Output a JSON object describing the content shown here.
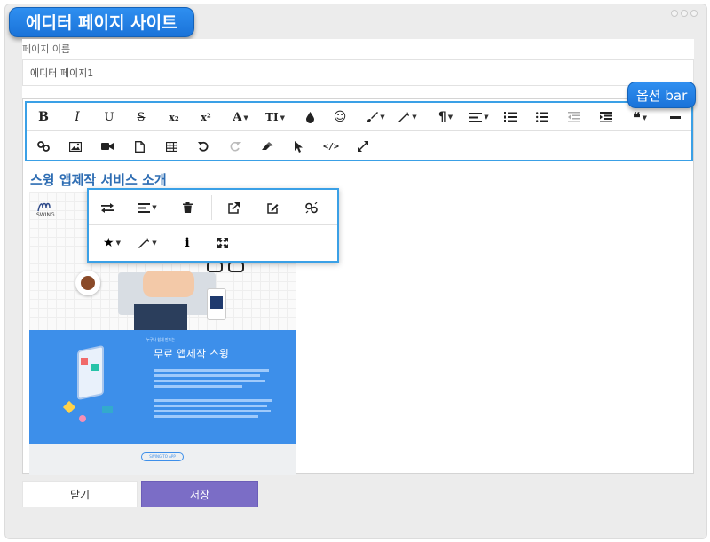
{
  "window": {
    "title": "에디터 페이지 사이트"
  },
  "form": {
    "name_label": "페이지 이름",
    "name_value": "에디터 페이지1"
  },
  "toolbar": {
    "badge": "옵션 bar",
    "buttons_row1": [
      {
        "name": "bold",
        "glyph": "B"
      },
      {
        "name": "italic",
        "glyph": "I"
      },
      {
        "name": "underline",
        "glyph": "U"
      },
      {
        "name": "strikethrough",
        "glyph": "S"
      },
      {
        "name": "subscript",
        "glyph": "x₂"
      },
      {
        "name": "superscript",
        "glyph": "x²"
      },
      {
        "name": "font-family",
        "glyph": "A"
      },
      {
        "name": "font-size",
        "glyph": "TI"
      }
    ]
  },
  "content": {
    "heading": "스윙 앱제작 서비스 소개",
    "image": {
      "logo_text": "SWING",
      "small_caption": "누구나 쉽게 만드는",
      "headline": "무료 앱제작 스윙",
      "footer_button": "SWING TO APP"
    }
  },
  "footer": {
    "close_label": "닫기",
    "save_label": "저장"
  },
  "colors": {
    "accent_blue": "#3aa0e6",
    "heading_blue": "#2e6db3",
    "save_purple": "#7b6dc6",
    "badge_blue": "#1a73d9"
  }
}
